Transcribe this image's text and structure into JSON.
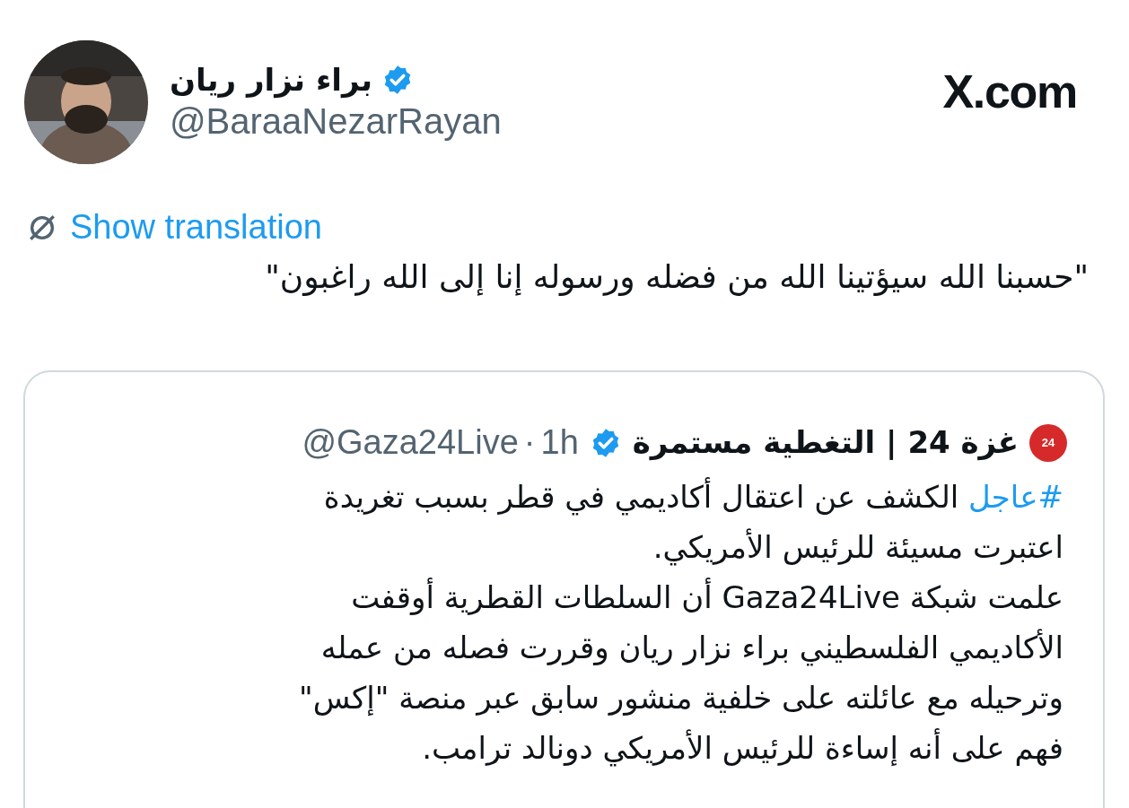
{
  "header": {
    "name": "براء نزار ريان",
    "verified": true,
    "handle": "@BaraaNezarRayan",
    "site": "X.com"
  },
  "translate_link": "Show translation",
  "text": "\"حسبنا الله سيؤتينا الله من فضله ورسوله إنا إلى الله راغبون\"",
  "quote": {
    "name": "غزة 24 | التغطية مستمرة",
    "verified": true,
    "logo_text": "24",
    "handle": "@Gaza24Live",
    "separator": "·",
    "time": "1h",
    "hashtag": "#عاجل",
    "lines": [
      "الكشف عن اعتقال أكاديمي في قطر بسبب تغريدة",
      "اعتبرت مسيئة للرئيس الأمريكي.",
      "علمت شبكة Gaza24Live أن السلطات القطرية أوقفت",
      "الأكاديمي الفلسطيني براء نزار ريان وقررت فصله من عمله",
      "وترحيله مع عائلته على خلفية منشور سابق عبر منصة \"إكس\"",
      "فهم على أنه إساءة للرئيس الأمريكي دونالد ترامب."
    ]
  }
}
